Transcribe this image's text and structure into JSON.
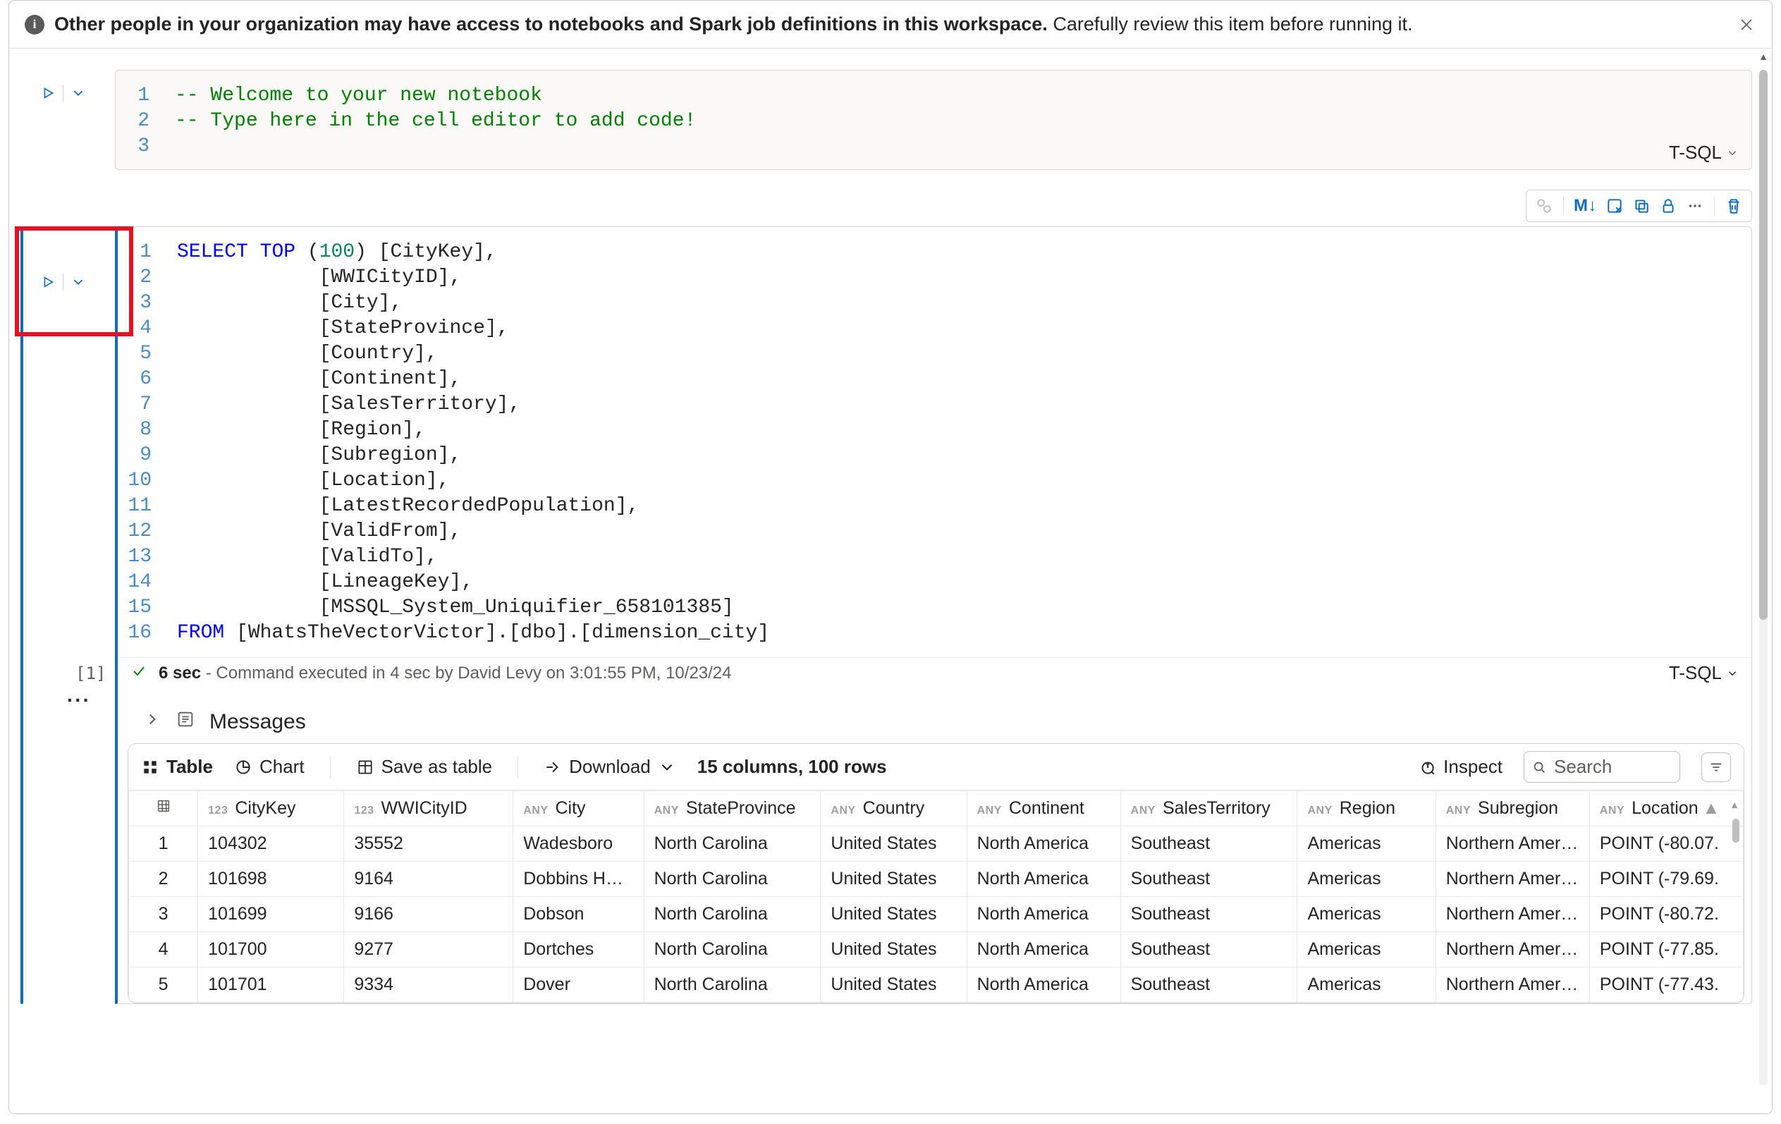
{
  "infobar": {
    "bold_text": "Other people in your organization may have access to notebooks and Spark job definitions in this workspace.",
    "rest_text": " Carefully review this item before running it."
  },
  "cell1": {
    "language": "T-SQL",
    "code_lines": [
      {
        "html": "<span class='tok-comment'>-- Welcome to your new notebook</span>"
      },
      {
        "html": "<span class='tok-comment'>-- Type here in the cell editor to add code!</span>"
      },
      {
        "html": ""
      }
    ]
  },
  "cell2": {
    "language": "T-SQL",
    "exec_label": "[1]",
    "exec_duration": "6 sec",
    "exec_message_prefix": " - Command executed in 4 sec by ",
    "exec_user": "David Levy",
    "exec_message_mid": " on ",
    "exec_timestamp": "3:01:55 PM, 10/23/24",
    "code_lines": [
      {
        "html": "<span class='tok-kw'>SELECT</span> <span class='tok-kw'>TOP</span> <span class='tok-punc'>(</span><span class='tok-num'>100</span><span class='tok-punc'>)</span> [CityKey]<span class='tok-punc'>,</span>"
      },
      {
        "html": "            [WWICityID]<span class='tok-punc'>,</span>"
      },
      {
        "html": "            [City]<span class='tok-punc'>,</span>"
      },
      {
        "html": "            [StateProvince]<span class='tok-punc'>,</span>"
      },
      {
        "html": "            [Country]<span class='tok-punc'>,</span>"
      },
      {
        "html": "            [Continent]<span class='tok-punc'>,</span>"
      },
      {
        "html": "            [SalesTerritory]<span class='tok-punc'>,</span>"
      },
      {
        "html": "            [Region]<span class='tok-punc'>,</span>"
      },
      {
        "html": "            [Subregion]<span class='tok-punc'>,</span>"
      },
      {
        "html": "            [Location]<span class='tok-punc'>,</span>"
      },
      {
        "html": "            [LatestRecordedPopulation]<span class='tok-punc'>,</span>"
      },
      {
        "html": "            [ValidFrom]<span class='tok-punc'>,</span>"
      },
      {
        "html": "            [ValidTo]<span class='tok-punc'>,</span>"
      },
      {
        "html": "            [LineageKey]<span class='tok-punc'>,</span>"
      },
      {
        "html": "            [MSSQL_System_Uniquifier_658101385]"
      },
      {
        "html": "<span class='tok-kw'>FROM</span> [WhatsTheVectorVictor].[dbo].[dimension_city]"
      }
    ]
  },
  "toolbar": {
    "markdown_label": "M↓"
  },
  "messages": {
    "label": "Messages"
  },
  "results": {
    "table_label": "Table",
    "chart_label": "Chart",
    "save_label": "Save as table",
    "download_label": "Download",
    "meta": "15 columns, 100 rows",
    "inspect_label": "Inspect",
    "search_placeholder": "Search",
    "columns": [
      {
        "type": "",
        "name": "",
        "idx": true
      },
      {
        "type": "123",
        "name": "CityKey"
      },
      {
        "type": "123",
        "name": "WWICityID"
      },
      {
        "type": "ANY",
        "name": "City"
      },
      {
        "type": "ANY",
        "name": "StateProvince"
      },
      {
        "type": "ANY",
        "name": "Country"
      },
      {
        "type": "ANY",
        "name": "Continent"
      },
      {
        "type": "ANY",
        "name": "SalesTerritory"
      },
      {
        "type": "ANY",
        "name": "Region"
      },
      {
        "type": "ANY",
        "name": "Subregion"
      },
      {
        "type": "ANY",
        "name": "Location",
        "sort": "asc"
      }
    ],
    "rows": [
      [
        "1",
        "104302",
        "35552",
        "Wadesboro",
        "North Carolina",
        "United States",
        "North America",
        "Southeast",
        "Americas",
        "Northern Amer…",
        "POINT (-80.07."
      ],
      [
        "2",
        "101698",
        "9164",
        "Dobbins H…",
        "North Carolina",
        "United States",
        "North America",
        "Southeast",
        "Americas",
        "Northern Amer…",
        "POINT (-79.69."
      ],
      [
        "3",
        "101699",
        "9166",
        "Dobson",
        "North Carolina",
        "United States",
        "North America",
        "Southeast",
        "Americas",
        "Northern Amer…",
        "POINT (-80.72."
      ],
      [
        "4",
        "101700",
        "9277",
        "Dortches",
        "North Carolina",
        "United States",
        "North America",
        "Southeast",
        "Americas",
        "Northern Amer…",
        "POINT (-77.85."
      ],
      [
        "5",
        "101701",
        "9334",
        "Dover",
        "North Carolina",
        "United States",
        "North America",
        "Southeast",
        "Americas",
        "Northern Amer…",
        "POINT (-77.43."
      ]
    ]
  }
}
